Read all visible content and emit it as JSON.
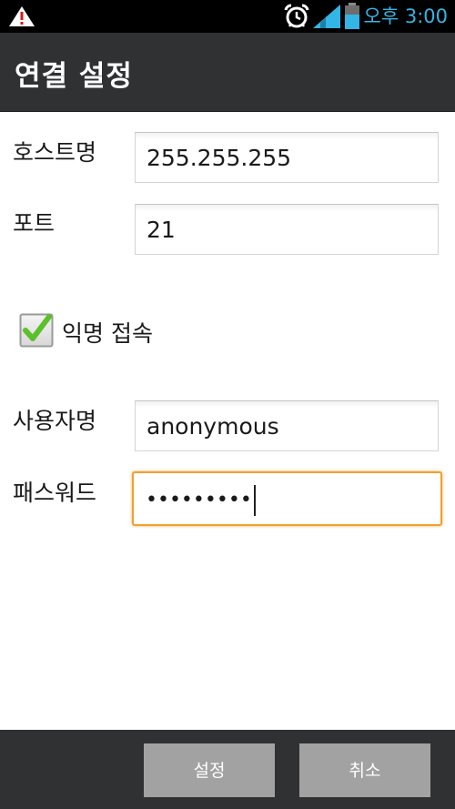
{
  "status_bar": {
    "time": "오후 3:00",
    "icons": [
      "warning-icon",
      "alarm-icon",
      "signal-icon",
      "battery-icon"
    ],
    "time_color": "#33b5e5"
  },
  "header": {
    "title": "연결 설정"
  },
  "form": {
    "host_label": "호스트명",
    "host_value": "255.255.255",
    "port_label": "포트",
    "port_value": "21",
    "anonymous_label": "익명 접속",
    "anonymous_checked": true,
    "username_label": "사용자명",
    "username_value": "anonymous",
    "password_label": "패스워드",
    "password_value": "•••••••••"
  },
  "buttons": {
    "confirm": "설정",
    "cancel": "취소"
  },
  "colors": {
    "focus_border": "#f0a030",
    "bar_background": "#2f3133",
    "button_background": "#a2a2a2",
    "check_green": "#5cc02a"
  }
}
